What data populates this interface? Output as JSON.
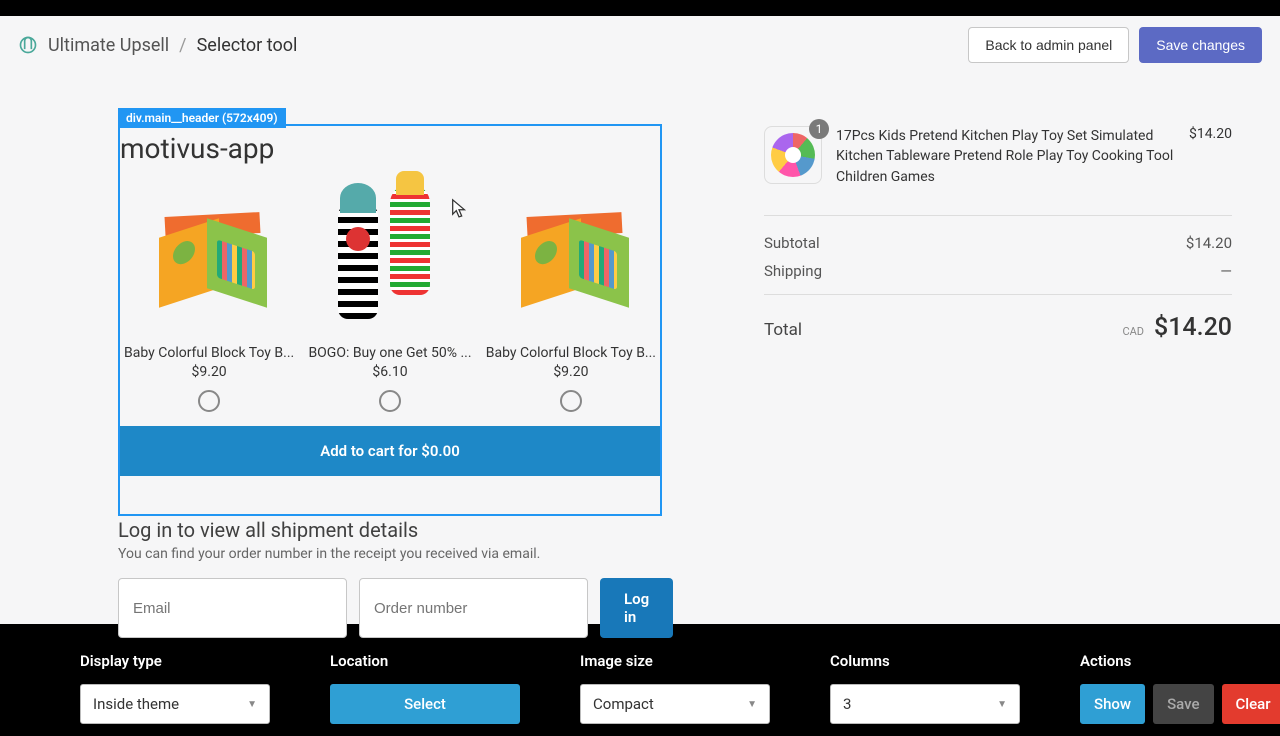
{
  "header": {
    "app_name": "Ultimate Upsell",
    "page": "Selector tool",
    "back_label": "Back to admin panel",
    "save_label": "Save changes"
  },
  "selector": {
    "tag": "div.main__header (572x409)"
  },
  "widget": {
    "title": "motivus-app",
    "products": [
      {
        "name": "Baby Colorful Block Toy B...",
        "price": "$9.20"
      },
      {
        "name": "BOGO: Buy one Get 50% ...",
        "price": "$6.10"
      },
      {
        "name": "Baby Colorful Block Toy B...",
        "price": "$9.20"
      }
    ],
    "add_to_cart": "Add to cart for $0.00"
  },
  "login": {
    "heading": "Log in to view all shipment details",
    "sub": "You can find your order number in the receipt you received via email.",
    "email_ph": "Email",
    "order_ph": "Order number",
    "btn": "Log in"
  },
  "cart": {
    "item": {
      "qty": "1",
      "name": "17Pcs Kids Pretend Kitchen Play Toy Set Simulated Kitchen Tableware Pretend Role Play Toy Cooking Tool Children Games",
      "price": "$14.20"
    },
    "subtotal_label": "Subtotal",
    "subtotal": "$14.20",
    "shipping_label": "Shipping",
    "shipping": "—",
    "total_label": "Total",
    "currency": "CAD",
    "total": "$14.20"
  },
  "bottombar": {
    "display_type": {
      "label": "Display type",
      "value": "Inside theme"
    },
    "location": {
      "label": "Location",
      "button": "Select"
    },
    "image_size": {
      "label": "Image size",
      "value": "Compact"
    },
    "columns": {
      "label": "Columns",
      "value": "3"
    },
    "actions": {
      "label": "Actions",
      "show": "Show",
      "save": "Save",
      "clear": "Clear"
    }
  }
}
